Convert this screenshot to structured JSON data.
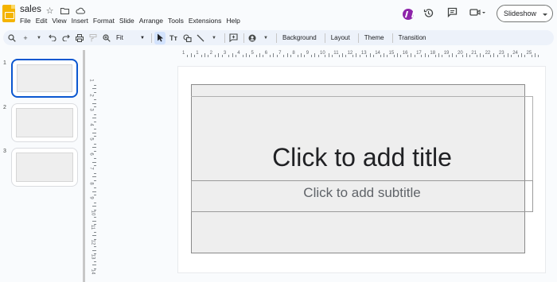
{
  "document": {
    "title": "sales"
  },
  "menu": [
    "File",
    "Edit",
    "View",
    "Insert",
    "Format",
    "Slide",
    "Arrange",
    "Tools",
    "Extensions",
    "Help"
  ],
  "header_actions": {
    "slideshow_label": "Slideshow"
  },
  "toolbar": {
    "zoom_value": "Fit",
    "background_label": "Background",
    "layout_label": "Layout",
    "theme_label": "Theme",
    "transition_label": "Transition"
  },
  "filmstrip": {
    "slides": [
      {
        "number": "1",
        "selected": true
      },
      {
        "number": "2",
        "selected": false
      },
      {
        "number": "3",
        "selected": false
      }
    ]
  },
  "ruler": {
    "horizontal": [
      "1",
      "1",
      "2",
      "3",
      "4",
      "5",
      "6",
      "7",
      "8",
      "9",
      "10",
      "11",
      "12",
      "13",
      "14",
      "15",
      "16",
      "17",
      "18",
      "19",
      "20",
      "21",
      "22",
      "23",
      "24",
      "25"
    ],
    "vertical": [
      "1",
      "2",
      "3",
      "4",
      "5",
      "6",
      "7",
      "8",
      "9",
      "10",
      "11",
      "12",
      "13",
      "14"
    ]
  },
  "slide": {
    "title_placeholder": "Click to add title",
    "subtitle_placeholder": "Click to add subtitle"
  },
  "colors": {
    "accent": "#0b57d0",
    "toolbar_bg": "#edf2fa",
    "logo": "#f4b400",
    "gemini": "#8e24aa"
  }
}
